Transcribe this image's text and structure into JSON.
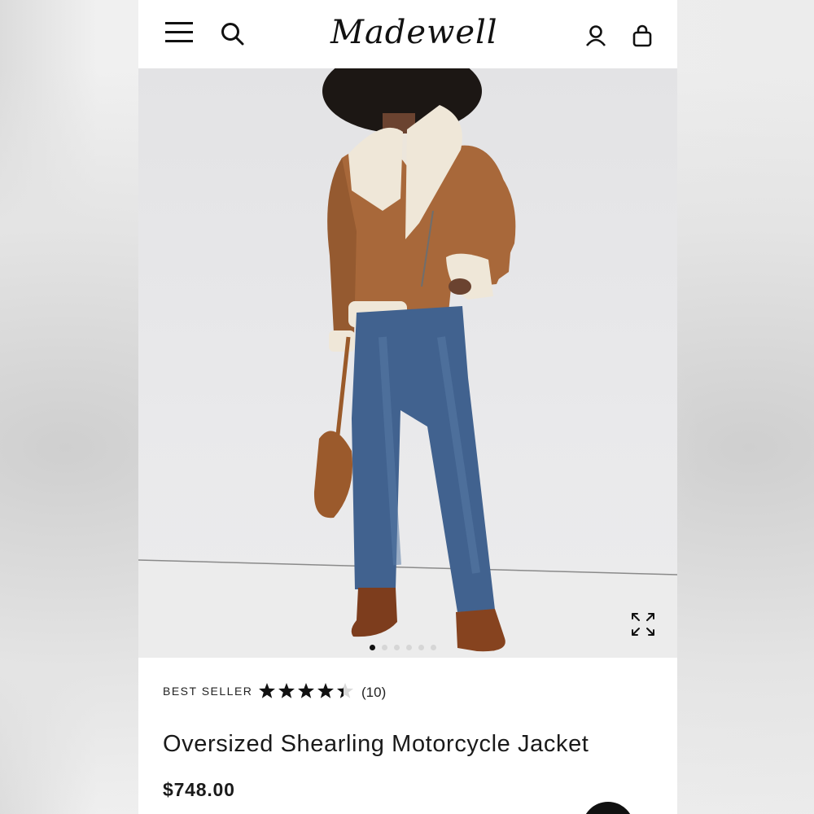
{
  "header": {
    "brand": "Madewell",
    "icons": [
      "menu-icon",
      "search-icon",
      "account-icon",
      "bag-icon"
    ]
  },
  "hero": {
    "image": "model wearing brown shearling motorcycle jacket, wide-leg jeans, brown boots and hobo bag",
    "carousel_total": 6,
    "carousel_active": 1,
    "expand_icon": "expand-icon"
  },
  "product": {
    "badge": "BEST SELLER",
    "rating": 4.5,
    "rating_max": 5,
    "review_count": "(10)",
    "name": "Oversized Shearling Motorcycle Jacket",
    "price": "$748.00"
  },
  "colors": {
    "text": "#1a1a1a",
    "background": "#ffffff",
    "accent": "#111111"
  }
}
